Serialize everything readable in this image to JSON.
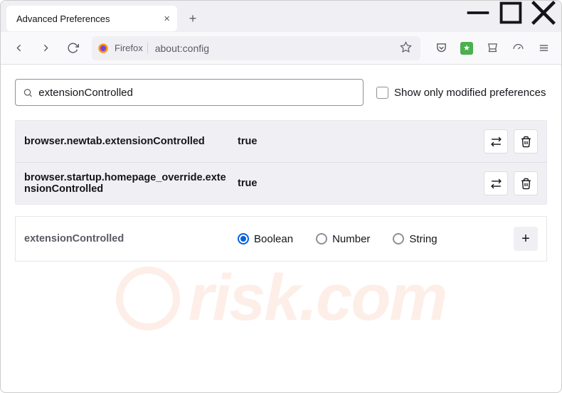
{
  "window": {
    "tab_title": "Advanced Preferences",
    "urlbar_label": "Firefox",
    "url": "about:config"
  },
  "search": {
    "value": "extensionControlled",
    "checkbox_label": "Show only modified preferences"
  },
  "prefs": [
    {
      "name": "browser.newtab.extensionControlled",
      "value": "true"
    },
    {
      "name": "browser.startup.homepage_override.extensionControlled",
      "value": "true"
    }
  ],
  "newpref": {
    "name": "extensionControlled",
    "types": [
      "Boolean",
      "Number",
      "String"
    ],
    "selected": "Boolean"
  },
  "watermark": "risk.com"
}
